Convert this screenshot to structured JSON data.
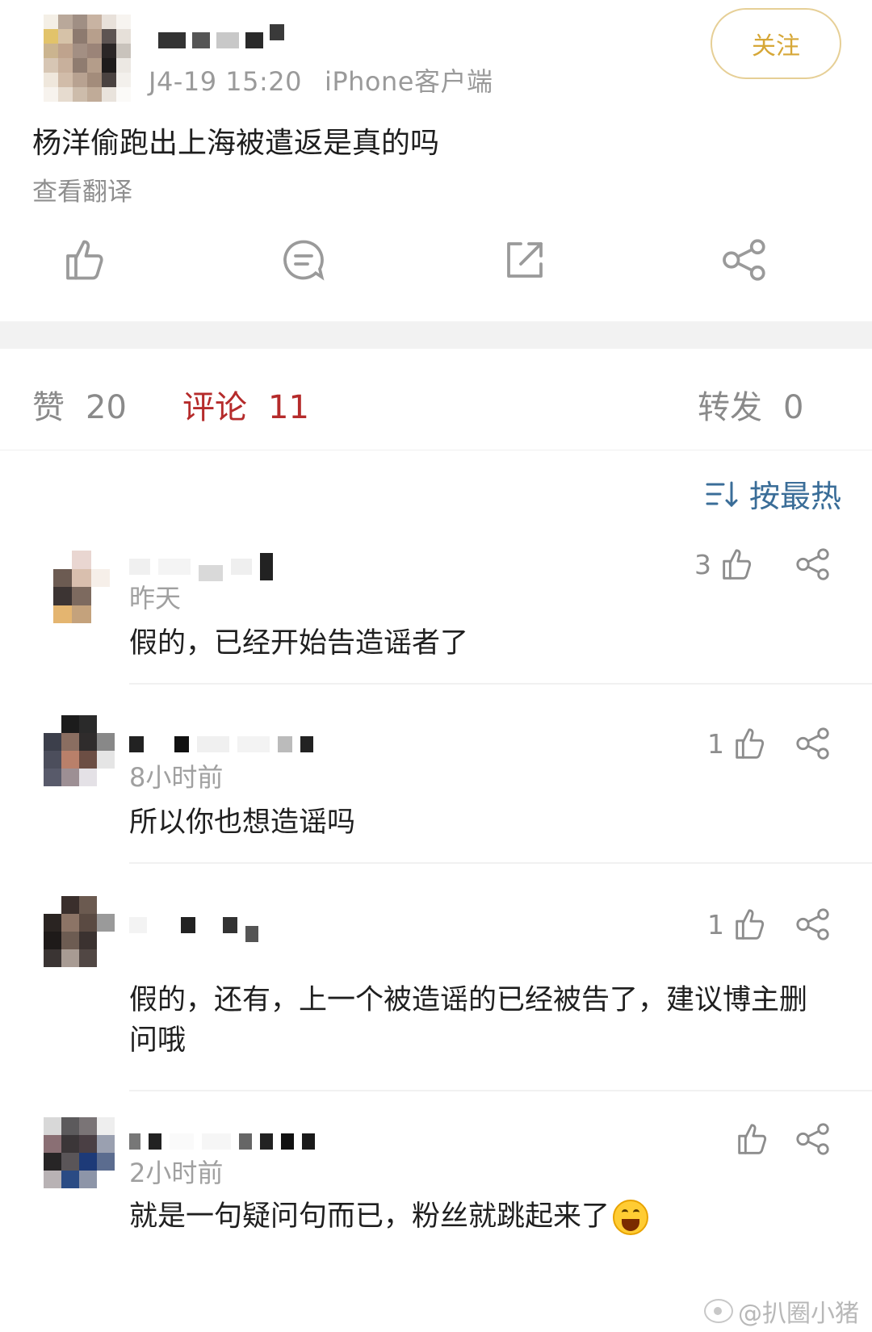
{
  "post": {
    "meta_time": "J4-19 15:20",
    "meta_source": "iPhone客户端",
    "follow_label": "关注",
    "text": "杨洋偷跑出上海被遣返是真的吗",
    "translate_label": "查看翻译",
    "action_icons": [
      "thumbs-up-icon",
      "comment-icon",
      "repost-icon",
      "share-icon"
    ]
  },
  "stats": {
    "likes_label": "赞",
    "likes_count": "20",
    "comments_label": "评论",
    "comments_count": "11",
    "reposts_label": "转发",
    "reposts_count": "0",
    "active_color": "#b52b2b"
  },
  "sort": {
    "label": "按最热",
    "icon": "sort-icon",
    "color": "#3a6d98"
  },
  "comments": [
    {
      "time": "昨天",
      "text": "假的，已经开始告造谣者了",
      "likes": "3"
    },
    {
      "time": "8小时前",
      "text": "所以你也想造谣吗",
      "likes": "1"
    },
    {
      "time": "",
      "text": "假的，还有，上一个被造谣的已经被告了，建议博主删问哦",
      "likes": "1"
    },
    {
      "time": "2小时前",
      "text": "就是一句疑问句而已，粉丝就跳起来了",
      "likes": "",
      "emoji": "laughing-emoji"
    }
  ],
  "watermark": {
    "text": "@扒圈小猪"
  }
}
